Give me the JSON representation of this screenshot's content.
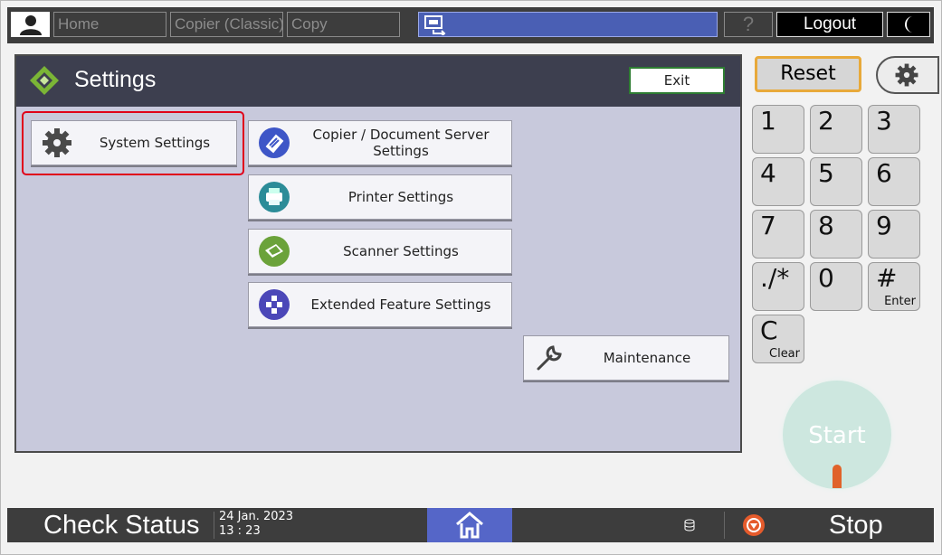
{
  "topbar": {
    "home": "Home",
    "copier_classic": "Copier (Classic)",
    "copy": "Copy",
    "help": "?",
    "logout": "Logout"
  },
  "panel": {
    "title": "Settings",
    "exit": "Exit",
    "buttons": {
      "system": "System Settings",
      "copier_line1": "Copier / Document Server",
      "copier_line2": "Settings",
      "printer": "Printer Settings",
      "scanner": "Scanner Settings",
      "extended": "Extended Feature Settings",
      "maintenance": "Maintenance"
    }
  },
  "keypad": {
    "reset": "Reset",
    "keys": [
      {
        "d": "1",
        "s": ""
      },
      {
        "d": "2",
        "s": ""
      },
      {
        "d": "3",
        "s": ""
      },
      {
        "d": "4",
        "s": ""
      },
      {
        "d": "5",
        "s": ""
      },
      {
        "d": "6",
        "s": ""
      },
      {
        "d": "7",
        "s": ""
      },
      {
        "d": "8",
        "s": ""
      },
      {
        "d": "9",
        "s": ""
      },
      {
        "d": "./*",
        "s": ""
      },
      {
        "d": "0",
        "s": ""
      },
      {
        "d": "#",
        "s": "Enter"
      },
      {
        "d": "C",
        "s": "Clear"
      }
    ],
    "start": "Start"
  },
  "bottombar": {
    "check_status": "Check Status",
    "date": "24 Jan. 2023",
    "time": "13 : 23",
    "stop": "Stop"
  },
  "colors": {
    "highlight": "#e0001a",
    "remote_bar": "#4a5fb4",
    "start_button": "#cde7df"
  }
}
